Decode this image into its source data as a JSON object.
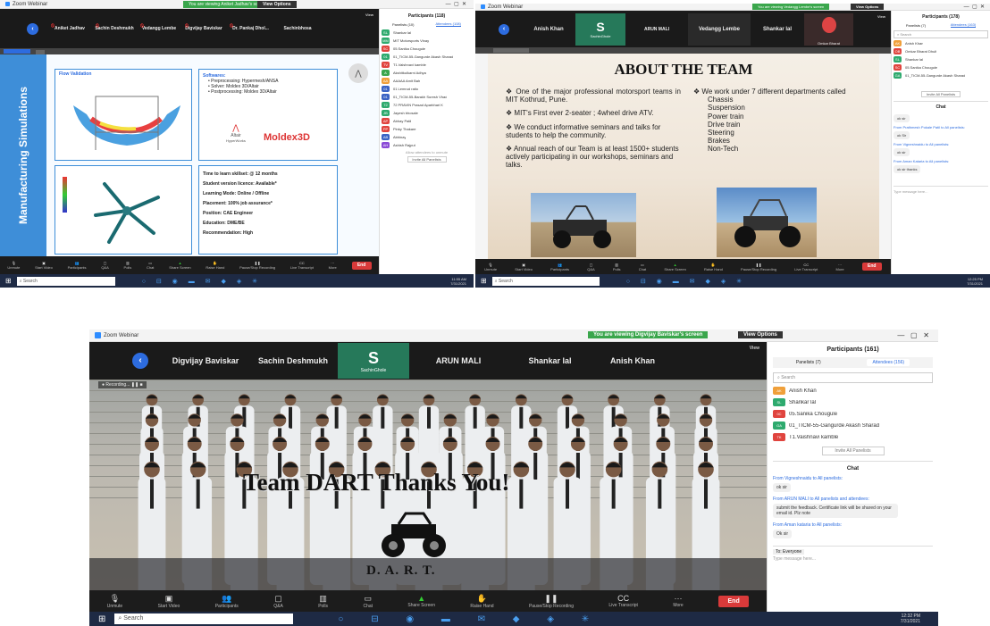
{
  "s1": {
    "title": "Zoom Webinar",
    "banner": "You are viewing Aniket Jadhav's screen",
    "view_options": "View Options",
    "names": [
      "Aniket Jadhav",
      "Sachin Deshmukh",
      "Vedangg Lembe",
      "Digvijay Baviskar",
      "Dr. Pankaj Dhol...",
      "Sachinbhosa"
    ],
    "view_label": "View",
    "slide": {
      "side_title": "Manufacturing Simulations",
      "flow_validation": "Flow Validation",
      "software_title": "Softwares:",
      "software_items": [
        "Preprocessing: Hypermesh/ANSA",
        "Solver: Moldex 3D/Altair",
        "Postprocessing: Moldex 3D/Altair"
      ],
      "altair_logo": "Altair",
      "hyperworks": "HyperWorks",
      "moldex_logo": "Moldex3D",
      "details": [
        "Time to learn skillset: @ 12 months",
        "Student version licence: Available*",
        "Learning Mode: Online / Offline",
        "Placement: 100% job assurance*",
        "Position: CAE Engineer",
        "Education: DME/BE",
        "Recommendation: High"
      ]
    },
    "panel": {
      "title": "Participants (118)",
      "tab_panelists": "Panelists (10)",
      "tab_attendees": "Attendees (108)",
      "rows": [
        {
          "initials": "SL",
          "name": "Shankar lal",
          "color": "#2eaa6e"
        },
        {
          "initials": "MM",
          "name": "MIT Motorsports Vinay",
          "color": "#2eaa6e"
        },
        {
          "initials": "SC",
          "name": "05.Sanika Chougule",
          "color": "#e0443e"
        },
        {
          "initials": "01",
          "name": "01_TICM-55-Gangurde Akash Sharad",
          "color": "#2eaa6e"
        },
        {
          "initials": "TV",
          "name": "T1.Vaishnavi kamble",
          "color": "#e0443e"
        },
        {
          "initials": "A",
          "name": "Akshitkulkarni Adhya",
          "color": "#3aa64c"
        },
        {
          "initials": "AA",
          "name": "AAAAA Amit Bah",
          "color": "#f0a03a"
        },
        {
          "initials": "01",
          "name": "01 Lemrud ratio",
          "color": "#3a63c4"
        },
        {
          "initials": "01",
          "name": "01_TICM-55-Barakh Suresh Vhad",
          "color": "#3a63c4"
        },
        {
          "initials": "72",
          "name": "72 PRAVIN Prasad Aparbhari K",
          "color": "#2eaa6e"
        },
        {
          "initials": "JB",
          "name": "Jayesh bhosale",
          "color": "#2eaa6e"
        },
        {
          "initials": "AP",
          "name": "Abhay Patil",
          "color": "#e0443e"
        },
        {
          "initials": "PP",
          "name": "Pinky Thakare",
          "color": "#e0443e"
        },
        {
          "initials": "AB",
          "name": "Abhinay",
          "color": "#3a63c4"
        },
        {
          "initials": "AH",
          "name": "Ashish Rajput",
          "color": "#8a4ad6"
        }
      ],
      "allow_note": "Allow attendees to unmute",
      "invite": "Invite All Panelists"
    },
    "toolbar": [
      "Unmute",
      "Start Video",
      "Participants",
      "Q&A",
      "Polls",
      "Chat",
      "Share Screen",
      "Raise Hand",
      "Pause/Stop Recording",
      "Live Transcript",
      "More"
    ],
    "end": "End",
    "search": "Search",
    "clock": {
      "time": "11:55 AM",
      "date": "7/31/2021"
    }
  },
  "s2": {
    "title": "Zoom Webinar",
    "banner": "You are viewing Vedangg Lembe's screen",
    "view_options": "View Options",
    "names": [
      "Anish Khan",
      "SachinGhole",
      "ARUN MALI",
      "Vedangg Lembe",
      "Shankar lal",
      "Omkar Bharat"
    ],
    "tile_letter": "S",
    "view_label": "View",
    "slide": {
      "title": "ABOUT THE TEAM",
      "left": [
        "One of the major professional motorsport teams in MIT Kothrud, Pune.",
        "MIT's First ever 2-seater ; 4wheel drive ATV.",
        "We conduct informative seminars and talks for students to help the community.",
        "Annual reach of our Team is at least 1500+ students actively participating in our workshops, seminars and talks."
      ],
      "right_intro": "We work under 7 different departments called",
      "departments": [
        "Chassis",
        "Suspension",
        "Power train",
        "Drive train",
        "Steering",
        "Brakes",
        "Non-Tech"
      ]
    },
    "panel": {
      "title": "Participants (178)",
      "tab_panelists": "Panelists (7)",
      "tab_attendees": "Attendees (163)",
      "search": "Search",
      "rows": [
        {
          "initials": "AK",
          "name": "Anish Khan",
          "color": "#f0a03a"
        },
        {
          "initials": "OB",
          "name": "Omkar Bharat Dhult",
          "color": "#e0443e"
        },
        {
          "initials": "SL",
          "name": "Shankar lal",
          "color": "#2eaa6e"
        },
        {
          "initials": "SC",
          "name": "05.Sanika Chougule",
          "color": "#e0443e"
        },
        {
          "initials": "GA",
          "name": "01_TICM-55-Gangurde Akash Sharad",
          "color": "#2eaa6e"
        }
      ],
      "invite": "Invite All Panelists",
      "chat_title": "Chat",
      "chat": [
        {
          "from": "",
          "msg": "ok sir"
        },
        {
          "from": "From Prathmesh Pokale Patil to All panelists:",
          "msg": "ok Sir"
        },
        {
          "from": "From Vigneshnaidu to All panelists:",
          "msg": "ok sir"
        },
        {
          "from": "From Aman Kataria to All panelists:",
          "msg": "ok sir thanks"
        }
      ],
      "chat_input": "Type message here..."
    },
    "toolbar": [
      "Unmute",
      "Start Video",
      "Participants",
      "Q&A",
      "Polls",
      "Chat",
      "Share Screen",
      "Raise Hand",
      "Pause/Stop Recording",
      "Live Transcript",
      "More"
    ],
    "end": "End",
    "search": "Search",
    "clock": {
      "time": "12:25 PM",
      "date": "7/31/2021"
    }
  },
  "s3": {
    "title": "Zoom Webinar",
    "banner": "You are viewing Digvijay Baviskar's screen",
    "view_options": "View Options",
    "names": [
      "Digvijay Baviskar",
      "Sachin Deshmukh",
      "SachinGhole",
      "ARUN MALI",
      "Shankar lal",
      "Anish Khan"
    ],
    "tile_letter": "S",
    "view_label": "View",
    "recording": "Recording...",
    "slide": {
      "headline": "Team DART Thanks You!",
      "logo_text": "D. A. R. T."
    },
    "panel": {
      "title": "Participants (161)",
      "tab_panelists": "Panelists (7)",
      "tab_attendees": "Attendees (156)",
      "search": "Search",
      "rows": [
        {
          "initials": "AK",
          "name": "Anish Khan",
          "color": "#f0a03a"
        },
        {
          "initials": "SL",
          "name": "Shankar lal",
          "color": "#2eaa6e"
        },
        {
          "initials": "0C",
          "name": "05.Sanika Chougule",
          "color": "#e0443e"
        },
        {
          "initials": "GA",
          "name": "01_TICM-55-Gangurde Akash Sharad",
          "color": "#2eaa6e"
        },
        {
          "initials": "TK",
          "name": "T1.Vaishnavi kamble",
          "color": "#e0443e"
        }
      ],
      "invite": "Invite All Panelists",
      "chat_title": "Chat",
      "chat": [
        {
          "from": "From Vigneshnaidu to All panelists:",
          "msg": "ok sir"
        },
        {
          "from": "From ARUN MALI to All panelists and attendees:",
          "msg": "submit the feedback. Certificate link will be shared on your email id. Plz note"
        },
        {
          "from": "From Aman kataria to All panelists:",
          "msg": "Ok sir"
        }
      ],
      "chat_input": "Type message here...",
      "chat_to": "To: Everyone"
    },
    "toolbar": [
      "Unmute",
      "Start Video",
      "Participants",
      "Q&A",
      "Polls",
      "Chat",
      "Share Screen",
      "Raise Hand",
      "Pause/Stop Recording",
      "Live Transcript",
      "More"
    ],
    "end": "End",
    "search": "Search",
    "clock": {
      "time": "12:32 PM",
      "date": "7/31/2021"
    }
  }
}
